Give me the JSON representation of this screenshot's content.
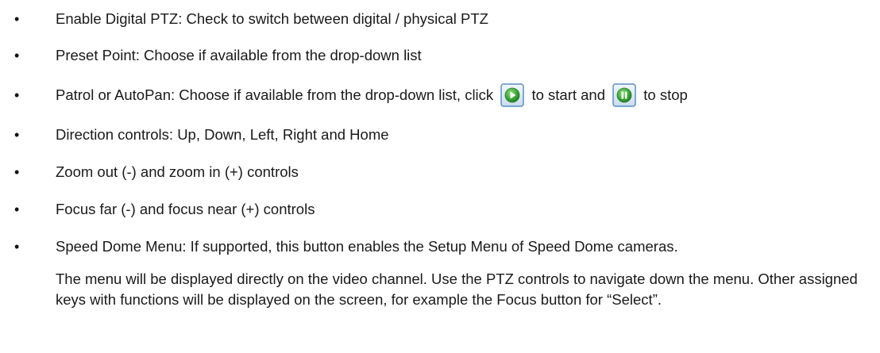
{
  "items": [
    {
      "bullet": "•",
      "text": "Enable Digital PTZ: Check to switch between digital / physical PTZ"
    },
    {
      "bullet": "•",
      "text": "Preset Point: Choose if available from the drop-down list"
    },
    {
      "bullet": "•",
      "text_before": "Patrol or AutoPan: Choose if available from the drop-down list, click",
      "text_middle": "to start and",
      "text_after": "to stop"
    },
    {
      "bullet": "•",
      "text": "Direction controls: Up, Down, Left, Right and Home"
    },
    {
      "bullet": "•",
      "text": "Zoom out (-) and zoom in (+) controls"
    },
    {
      "bullet": "•",
      "text": "Focus far (-) and focus near (+) controls"
    },
    {
      "bullet": "•",
      "text": "Speed Dome Menu: If supported, this button enables the Setup Menu of Speed Dome cameras."
    }
  ],
  "continuation": "The menu will be displayed directly on the video channel.  Use the PTZ controls to navigate down the menu.  Other assigned keys with functions will be displayed on the screen, for example the Focus button for “Select”.",
  "icons": {
    "start": "play-icon",
    "stop": "pause-icon"
  },
  "colors": {
    "icon_frame": "#5a8fc4",
    "icon_green": "#3aa635"
  }
}
